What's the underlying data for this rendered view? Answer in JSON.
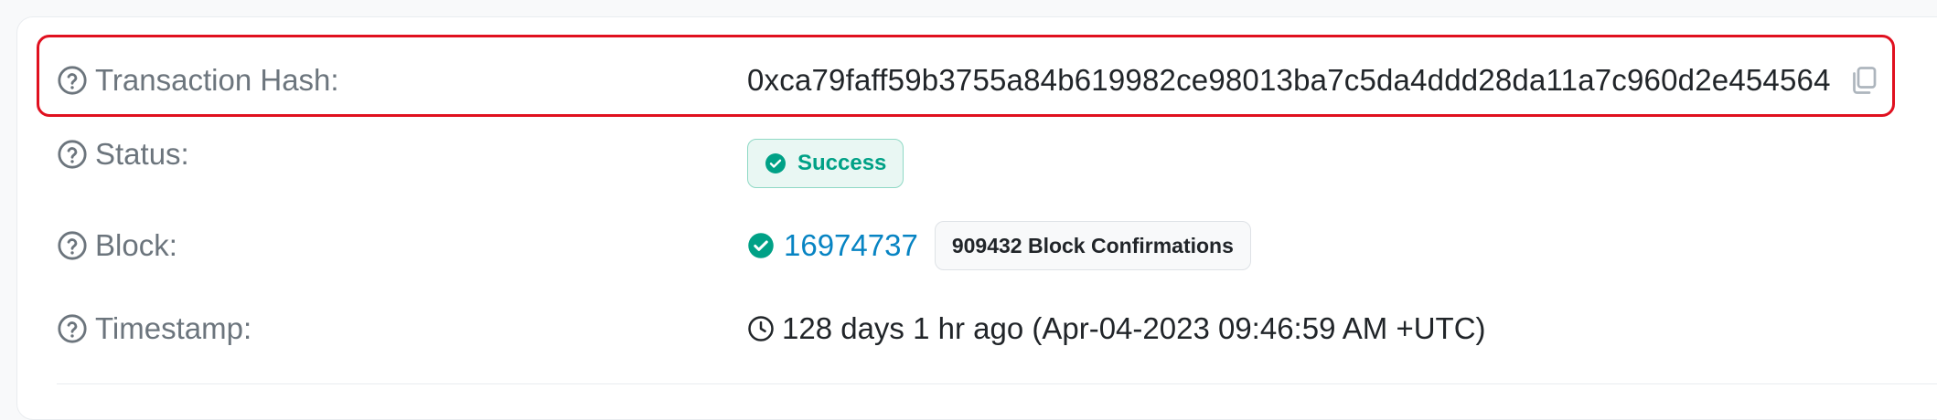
{
  "rows": {
    "hash": {
      "label": "Transaction Hash:",
      "value": "0xca79faff59b3755a84b619982ce98013ba7c5da4ddd28da11a7c960d2e454564"
    },
    "status": {
      "label": "Status:",
      "value": "Success"
    },
    "block": {
      "label": "Block:",
      "number": "16974737",
      "confirmations": "909432 Block Confirmations"
    },
    "timestamp": {
      "label": "Timestamp:",
      "value": "128 days 1 hr ago (Apr-04-2023 09:46:59 AM +UTC)"
    }
  },
  "icons": {
    "help": "question-circle-icon",
    "copy": "copy-icon",
    "success": "check-circle-icon",
    "clock": "clock-icon"
  },
  "colors": {
    "highlight": "#e0101f",
    "success": "#00a186",
    "link": "#0784c3",
    "label": "#6c757d"
  }
}
